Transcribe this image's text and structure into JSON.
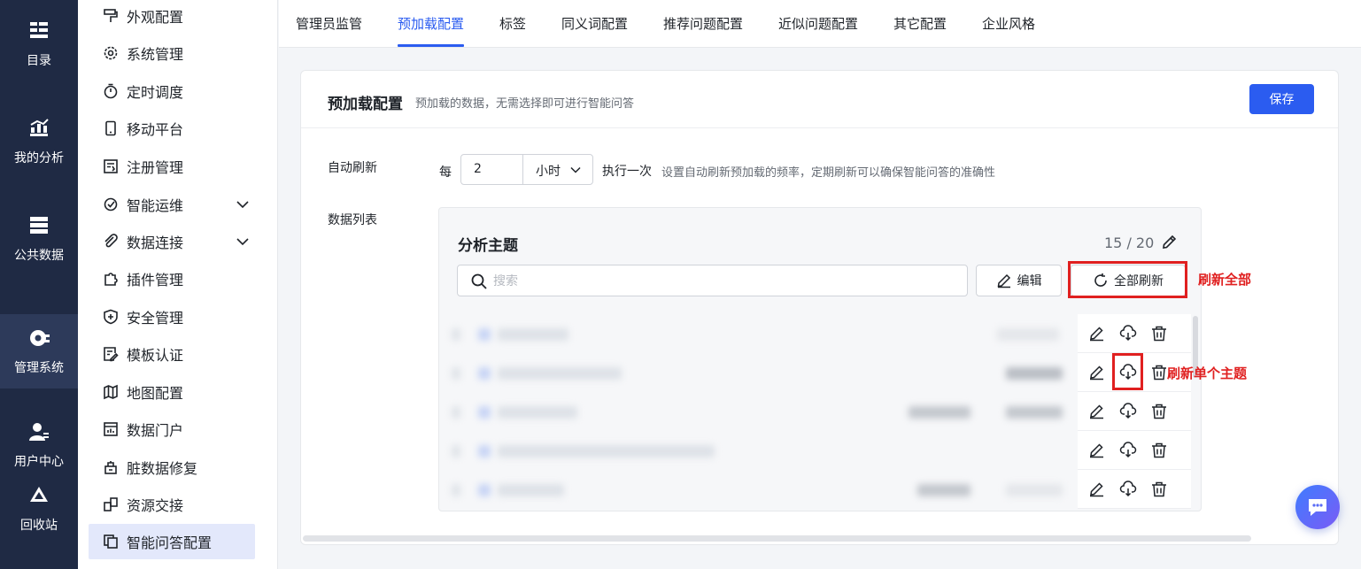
{
  "rail": {
    "items": [
      {
        "label": "目录",
        "icon": "catalog-icon"
      },
      {
        "label": "我的分析",
        "icon": "analysis-chart-icon"
      },
      {
        "label": "公共数据",
        "icon": "database-icon"
      },
      {
        "label": "管理系统",
        "icon": "gear-admin-icon",
        "active": true
      },
      {
        "label": "用户中心",
        "icon": "user-icon"
      },
      {
        "label": "回收站",
        "icon": "recycle-icon"
      }
    ]
  },
  "sidebar": {
    "items": [
      {
        "label": "外观配置",
        "icon": "paint-roller-icon"
      },
      {
        "label": "系统管理",
        "icon": "gear-icon"
      },
      {
        "label": "定时调度",
        "icon": "stopwatch-icon"
      },
      {
        "label": "移动平台",
        "icon": "mobile-icon"
      },
      {
        "label": "注册管理",
        "icon": "register-icon"
      },
      {
        "label": "智能运维",
        "icon": "ops-icon",
        "expandable": true
      },
      {
        "label": "数据连接",
        "icon": "link-clip-icon",
        "expandable": true
      },
      {
        "label": "插件管理",
        "icon": "puzzle-icon"
      },
      {
        "label": "安全管理",
        "icon": "shield-plus-icon"
      },
      {
        "label": "模板认证",
        "icon": "certificate-icon"
      },
      {
        "label": "地图配置",
        "icon": "map-icon"
      },
      {
        "label": "数据门户",
        "icon": "portal-icon"
      },
      {
        "label": "脏数据修复",
        "icon": "repair-icon"
      },
      {
        "label": "资源交接",
        "icon": "handover-icon"
      },
      {
        "label": "智能问答配置",
        "icon": "copy-qa-icon",
        "active": true
      }
    ]
  },
  "tabs": [
    "管理员监管",
    "预加载配置",
    "标签",
    "同义词配置",
    "推荐问题配置",
    "近似问题配置",
    "其它配置",
    "企业风格"
  ],
  "active_tab": "预加载配置",
  "card": {
    "title": "预加载配置",
    "description": "预加载的数据，无需选择即可进行智能问答",
    "save_label": "保存"
  },
  "auto_refresh": {
    "label": "自动刷新",
    "every": "每",
    "value": "2",
    "unit": "小时",
    "exec_once": "执行一次",
    "description": "设置自动刷新预加载的频率，定期刷新可以确保智能问答的准确性"
  },
  "data_list": {
    "label": "数据列表",
    "panel_title": "分析主题",
    "count": "15 / 20",
    "search_placeholder": "搜索",
    "edit_label": "编辑",
    "refresh_all_label": "全部刷新",
    "row_actions": [
      "pencil-edit-icon",
      "cloud-refresh-icon",
      "trash-icon"
    ]
  },
  "annotations": {
    "refresh_all": "刷新全部",
    "refresh_single": "刷新单个主题"
  },
  "colors": {
    "rail_bg": "#1f2a44",
    "primary": "#2b5cf0",
    "annotation_red": "#e02020",
    "active_item_bg": "#e3e8fb"
  }
}
